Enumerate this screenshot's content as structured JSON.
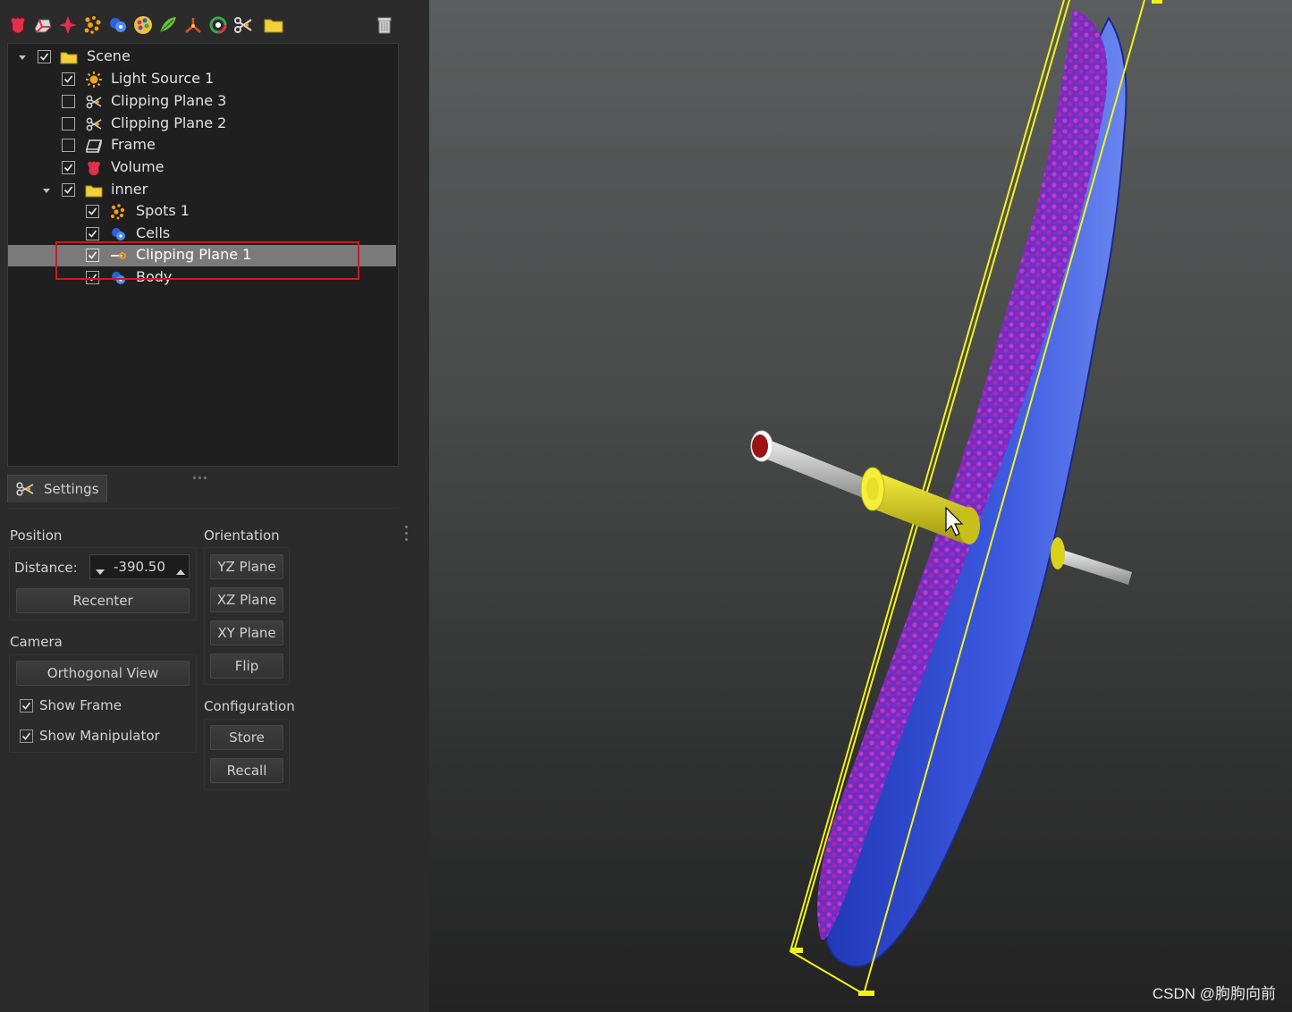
{
  "toolbar": {
    "icons": [
      "volume-icon",
      "surface-icon",
      "clipping-icon",
      "spots-icon",
      "cells-icon",
      "colors-icon",
      "filament-icon",
      "measurement-icon",
      "reference-frame-icon",
      "clipping-plane-icon",
      "group-folder-icon"
    ],
    "trash_icon": "trash-icon"
  },
  "tree": {
    "items": [
      {
        "label": "Scene",
        "checked": true,
        "expanded": true,
        "icon": "folder-icon"
      },
      {
        "label": "Light Source 1",
        "checked": true,
        "icon": "light-source-icon"
      },
      {
        "label": "Clipping Plane 3",
        "checked": false,
        "icon": "clipping-plane-icon"
      },
      {
        "label": "Clipping Plane 2",
        "checked": false,
        "icon": "clipping-plane-icon"
      },
      {
        "label": "Frame",
        "checked": false,
        "icon": "frame-icon"
      },
      {
        "label": "Volume",
        "checked": true,
        "icon": "volume-icon"
      },
      {
        "label": "inner",
        "checked": true,
        "expanded": true,
        "icon": "folder-icon"
      },
      {
        "label": "Spots 1",
        "checked": true,
        "icon": "spots-icon"
      },
      {
        "label": "Cells",
        "checked": true,
        "icon": "cells-icon"
      },
      {
        "label": "Clipping Plane 1",
        "checked": true,
        "icon": "clipping-plane-icon",
        "selected": true
      },
      {
        "label": "Body",
        "checked": true,
        "icon": "surface-icon"
      }
    ]
  },
  "settings": {
    "tab_label": "Settings",
    "position": {
      "label": "Position",
      "distance_label": "Distance:",
      "distance_value": "-390.50",
      "recenter": "Recenter"
    },
    "camera": {
      "label": "Camera",
      "orthogonal_view": "Orthogonal View",
      "show_frame": {
        "label": "Show Frame",
        "checked": true
      },
      "show_manipulator": {
        "label": "Show Manipulator",
        "checked": true
      }
    },
    "orientation": {
      "label": "Orientation",
      "yz": "YZ Plane",
      "xz": "XZ Plane",
      "xy": "XY Plane",
      "flip": "Flip"
    },
    "configuration": {
      "label": "Configuration",
      "store": "Store",
      "recall": "Recall"
    }
  },
  "viewport": {
    "watermark": "CSDN @朐朐向前",
    "colors": {
      "frame": "#f2f21a",
      "surface": "#3552d8",
      "spots": "#b02ab8",
      "manipulator": "#d9d21c",
      "handle_tip": "#9a1414"
    }
  }
}
